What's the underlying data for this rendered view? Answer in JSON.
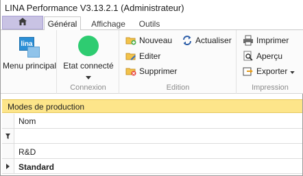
{
  "window": {
    "title": "LINA Performance  V3.13.2.1  (Administrateur)"
  },
  "tabs": [
    {
      "label": "Général",
      "active": true
    },
    {
      "label": "Affichage",
      "active": false
    },
    {
      "label": "Outils",
      "active": false
    }
  ],
  "ribbon": {
    "menu_principal": {
      "label": "Menu principal",
      "logo_text": "lina"
    },
    "connexion": {
      "state_label": "Etat connecté",
      "group_label": "Connexion",
      "status_color": "#2ecc71"
    },
    "edition": {
      "nouveau": "Nouveau",
      "editer": "Editer",
      "supprimer": "Supprimer",
      "actualiser": "Actualiser",
      "group_label": "Edition"
    },
    "impression": {
      "imprimer": "Imprimer",
      "apercu": "Aperçu",
      "exporter": "Exporter",
      "group_label": "Impression"
    }
  },
  "section": {
    "title": "Modes de production"
  },
  "grid": {
    "column": "Nom",
    "rows": [
      {
        "name": "R&D",
        "selected": false
      },
      {
        "name": "Standard",
        "selected": true
      }
    ]
  },
  "colors": {
    "accent_tab": "#c9c3e4",
    "section_bar": "#fde58a"
  }
}
